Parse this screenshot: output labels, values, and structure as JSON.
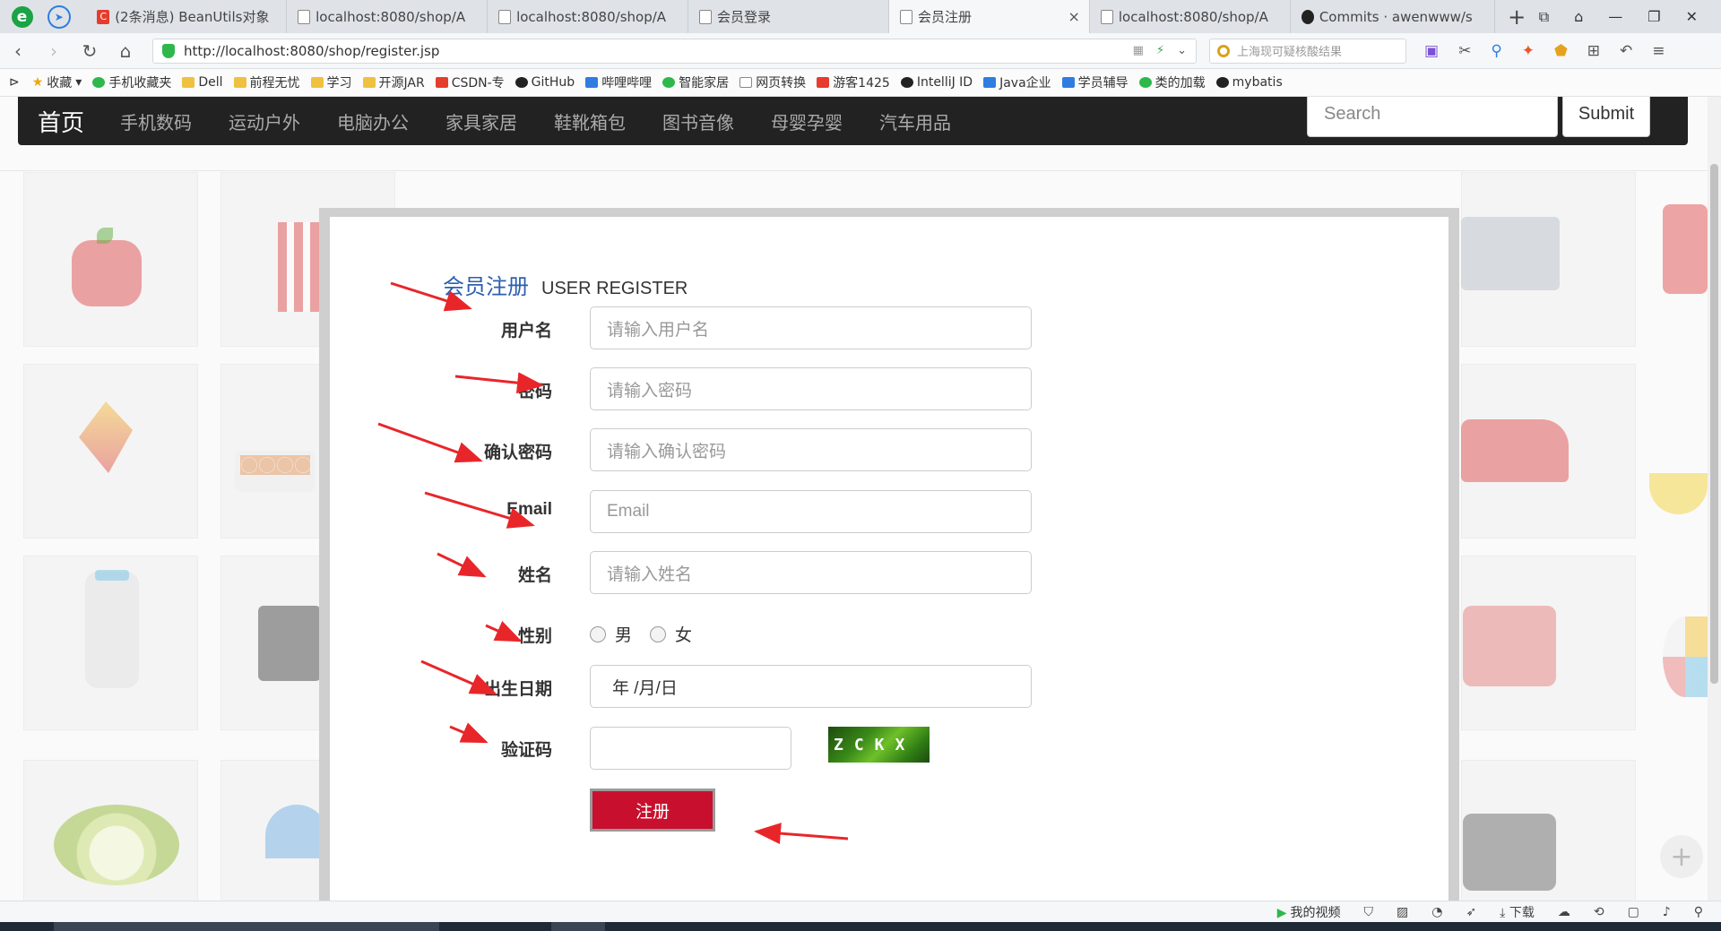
{
  "browser": {
    "tabs": [
      {
        "title": "(2条消息) BeanUtils对象",
        "favicon": "csdn"
      },
      {
        "title": "localhost:8080/shop/A",
        "favicon": "page"
      },
      {
        "title": "localhost:8080/shop/A",
        "favicon": "page"
      },
      {
        "title": "会员登录",
        "favicon": "page"
      },
      {
        "title": "会员注册",
        "favicon": "page",
        "active": true
      },
      {
        "title": "localhost:8080/shop/A",
        "favicon": "page"
      },
      {
        "title": "Commits · awenwww/s",
        "favicon": "github"
      }
    ],
    "tab_close": "×",
    "new_tab": "+",
    "url": "http://localhost:8080/shop/register.jsp",
    "search_box_text": "上海现可疑核酸结果",
    "bookmarks": [
      {
        "label": "收藏",
        "icon": "star"
      },
      {
        "label": "手机收藏夹",
        "icon": "green"
      },
      {
        "label": "Dell",
        "icon": "folder"
      },
      {
        "label": "前程无忧",
        "icon": "folder"
      },
      {
        "label": "学习",
        "icon": "folder"
      },
      {
        "label": "开源JAR",
        "icon": "folder"
      },
      {
        "label": "CSDN-专",
        "icon": "red"
      },
      {
        "label": "GitHub",
        "icon": "dark"
      },
      {
        "label": "哔哩哔哩",
        "icon": "blue"
      },
      {
        "label": "智能家居",
        "icon": "green"
      },
      {
        "label": "网页转换",
        "icon": "page"
      },
      {
        "label": "游客1425",
        "icon": "red"
      },
      {
        "label": "IntelliJ ID",
        "icon": "dark"
      },
      {
        "label": "Java企业",
        "icon": "blue"
      },
      {
        "label": "学员辅导",
        "icon": "blue"
      },
      {
        "label": "类的加载",
        "icon": "green"
      },
      {
        "label": "mybatis",
        "icon": "dark"
      }
    ],
    "status": {
      "video": "我的视频",
      "download": "下载"
    }
  },
  "site": {
    "brand": "首页",
    "nav": [
      "手机数码",
      "运动户外",
      "电脑办公",
      "家具家居",
      "鞋靴箱包",
      "图书音像",
      "母婴孕婴",
      "汽车用品"
    ],
    "search_placeholder": "Search",
    "submit_label": "Submit"
  },
  "register": {
    "title_cn": "会员注册",
    "title_en": "USER REGISTER",
    "fields": {
      "username": {
        "label": "用户名",
        "placeholder": "请输入用户名"
      },
      "password": {
        "label": "密码",
        "placeholder": "请输入密码"
      },
      "confirm": {
        "label": "确认密码",
        "placeholder": "请输入确认密码"
      },
      "email": {
        "label": "Email",
        "placeholder": "Email"
      },
      "name": {
        "label": "姓名",
        "placeholder": "请输入姓名"
      },
      "gender": {
        "label": "性别",
        "options": [
          "男",
          "女"
        ]
      },
      "birthday": {
        "label": "出生日期",
        "value": "年 /月/日"
      },
      "captcha": {
        "label": "验证码",
        "image_text": "ZCKX"
      }
    },
    "submit_label": "注册"
  },
  "colors": {
    "nav_bg": "#222222",
    "title_blue": "#2d5fae",
    "register_red": "#c8102e",
    "arrow_red": "#e8262a"
  }
}
